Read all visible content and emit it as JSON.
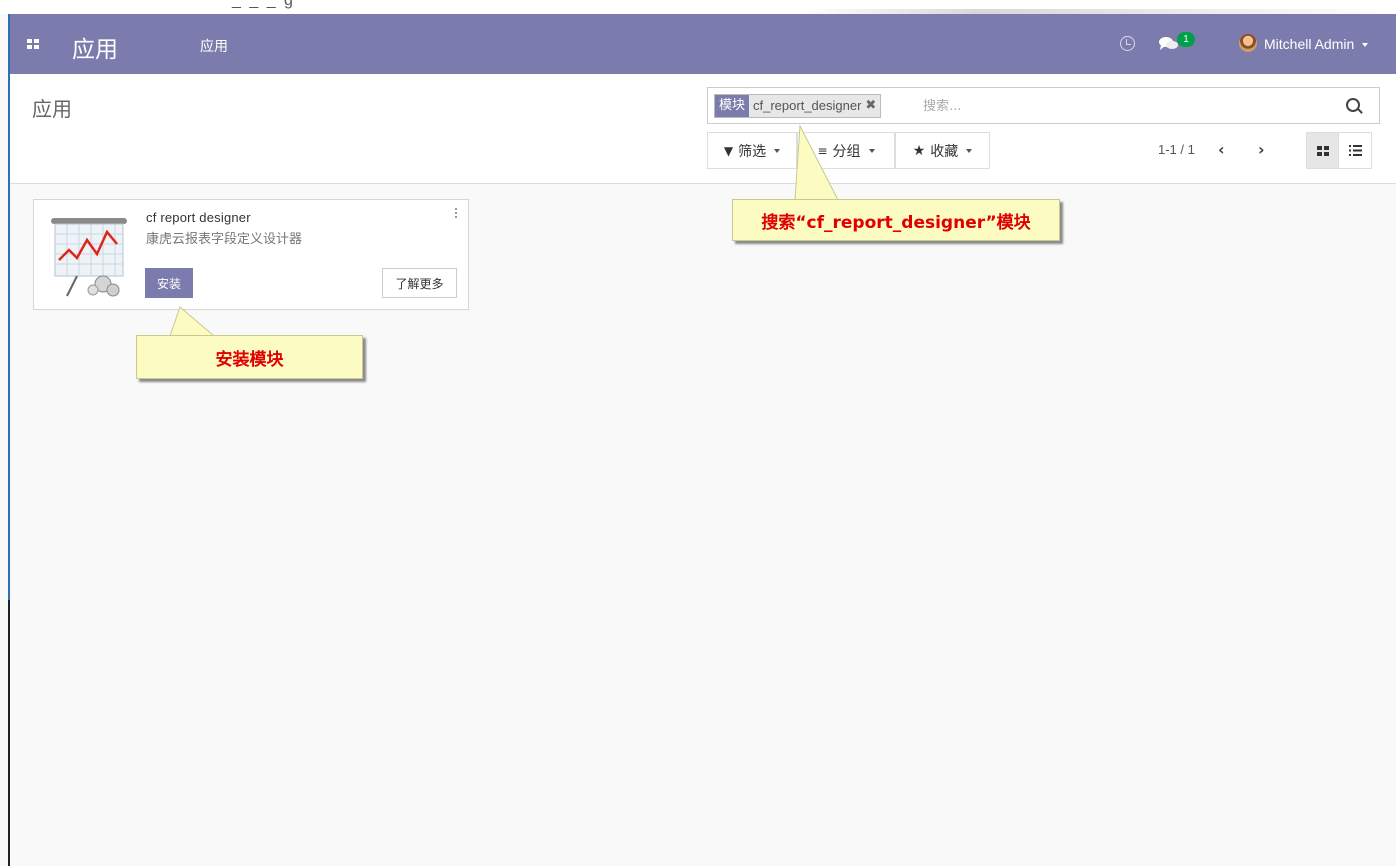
{
  "navbar": {
    "brand": "应用",
    "menu_item": "应用",
    "messages_count": "1",
    "user_name": "Mitchell Admin",
    "color": "#7c7bad"
  },
  "control_panel": {
    "breadcrumb": "应用",
    "search": {
      "facet_category": "模块",
      "facet_value": "cf_report_designer",
      "placeholder": "搜索..."
    },
    "filter_label": "筛选",
    "groupby_label": "分组",
    "favorites_label": "收藏",
    "pager": "1-1 / 1"
  },
  "cards": [
    {
      "name": "cf report designer",
      "description": "康虎云报表字段定义设计器",
      "install_label": "安装",
      "learn_more_label": "了解更多"
    }
  ],
  "annotations": {
    "search_callout": "搜索“cf_report_designer”模块",
    "install_callout": "安装模块"
  },
  "colors": {
    "accent": "#7c7bad",
    "callout_bg": "#fbfbc2",
    "callout_text": "#e00000"
  }
}
